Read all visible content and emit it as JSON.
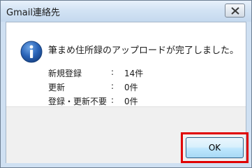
{
  "window": {
    "title": "Gmail連絡先"
  },
  "message": "筆まめ住所録のアップロードが完了しました。",
  "details": [
    {
      "label": "新規登録",
      "colon": ":",
      "value": "14件"
    },
    {
      "label": "更新",
      "colon": ":",
      "value": "0件"
    },
    {
      "label": "登録・更新不要",
      "colon": ":",
      "value": "0件"
    }
  ],
  "buttons": {
    "ok_label": "OK"
  },
  "icons": {
    "close": "close-icon",
    "info": "information-icon"
  },
  "colors": {
    "highlight": "#e00000",
    "info_icon": "#2a64b8"
  }
}
